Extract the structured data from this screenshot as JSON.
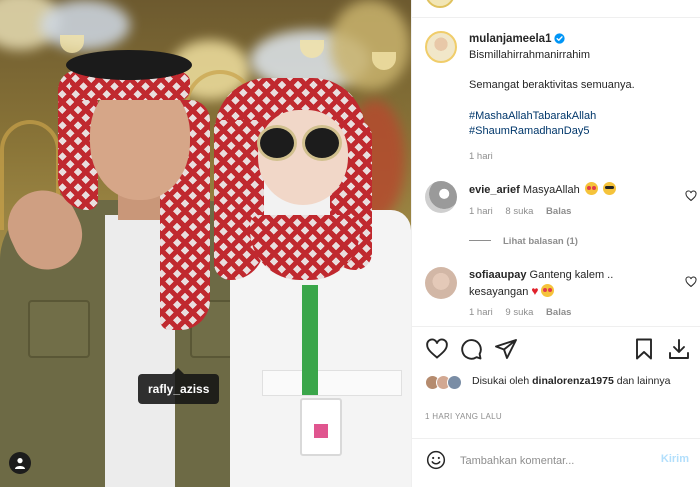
{
  "post": {
    "tagged_user": "rafly_aziss"
  },
  "caption": {
    "username": "mulanjameela1",
    "line1": "Bismillahirrahmanirrahim",
    "line2": "Semangat beraktivitas semuanya.",
    "hashtag1": "#MashaAllahTabarakAllah",
    "hashtag2": "#ShaumRamadhanDay5",
    "time": "1 hari"
  },
  "comments": [
    {
      "username": "evie_arief",
      "text": "MasyaAllah",
      "time": "1 hari",
      "likes": "8 suka",
      "reply": "Balas"
    },
    {
      "username": "sofiaaupay",
      "text": "Ganteng kalem .. kesayangan",
      "time": "1 hari",
      "likes": "9 suka",
      "reply": "Balas"
    }
  ],
  "view_replies": "Lihat balasan (1)",
  "likes": {
    "prefix": "Disukai oleh",
    "user": "dinalorenza1975",
    "suffix": "dan lainnya"
  },
  "date": "1 HARI YANG LALU",
  "comment_box": {
    "placeholder": "Tambahkan komentar...",
    "post_label": "Kirim"
  },
  "colors": {
    "link": "#00376b",
    "muted": "#8e8e8e",
    "post_disabled": "#b2dffc",
    "verified": "#0095f6"
  }
}
